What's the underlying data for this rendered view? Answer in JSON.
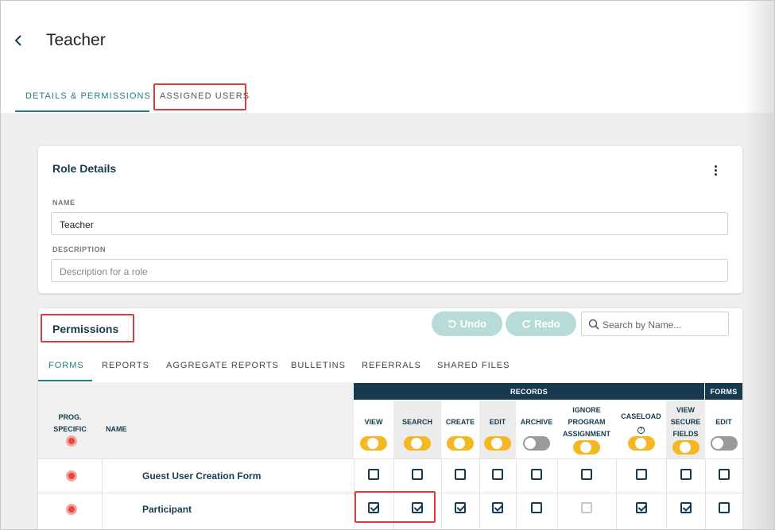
{
  "page": {
    "title": "Teacher"
  },
  "tabs": [
    {
      "label": "DETAILS & PERMISSIONS"
    },
    {
      "label": "ASSIGNED USERS"
    }
  ],
  "role_details": {
    "title": "Role Details",
    "name_label": "NAME",
    "name_value": "Teacher",
    "description_label": "DESCRIPTION",
    "description_placeholder": "Description for a role"
  },
  "permissions": {
    "title": "Permissions",
    "undo_label": "Undo",
    "redo_label": "Redo",
    "search_placeholder": "Search by Name...",
    "tabs": [
      "FORMS",
      "REPORTS",
      "AGGREGATE REPORTS",
      "BULLETINS",
      "REFERRALS",
      "SHARED FILES"
    ],
    "group_records": "RECORDS",
    "group_forms": "FORMS",
    "col_prog_specific_1": "PROG.",
    "col_prog_specific_2": "SPECIFIC",
    "col_name": "NAME",
    "columns": [
      {
        "l1": "VIEW",
        "l2": "",
        "l3": "",
        "toggle": "on"
      },
      {
        "l1": "SEARCH",
        "l2": "",
        "l3": "",
        "toggle": "on"
      },
      {
        "l1": "CREATE",
        "l2": "",
        "l3": "",
        "toggle": "on"
      },
      {
        "l1": "EDIT",
        "l2": "",
        "l3": "",
        "toggle": "on"
      },
      {
        "l1": "ARCHIVE",
        "l2": "",
        "l3": "",
        "toggle": "off"
      },
      {
        "l1": "IGNORE",
        "l2": "PROGRAM",
        "l3": "ASSIGNMENT",
        "toggle": "on"
      },
      {
        "l1": "CASELOAD",
        "l2": "?",
        "l3": "",
        "toggle": "on"
      },
      {
        "l1": "VIEW",
        "l2": "SECURE",
        "l3": "FIELDS",
        "toggle": "on"
      },
      {
        "l1": "EDIT",
        "l2": "",
        "l3": "",
        "toggle": "off"
      }
    ],
    "rows": [
      {
        "name": "Guest User Creation Form",
        "checks": [
          "unchecked",
          "unchecked",
          "unchecked",
          "unchecked",
          "unchecked",
          "unchecked",
          "unchecked",
          "unchecked",
          "unchecked"
        ]
      },
      {
        "name": "Participant",
        "checks": [
          "checked",
          "checked",
          "checked",
          "checked",
          "unchecked",
          "disabled",
          "checked",
          "checked",
          "unchecked"
        ]
      }
    ]
  },
  "colors": {
    "accent": "#1f7d78",
    "navy": "#163a4f",
    "toggle_on": "#f5b822",
    "highlight": "#e03a3a"
  }
}
